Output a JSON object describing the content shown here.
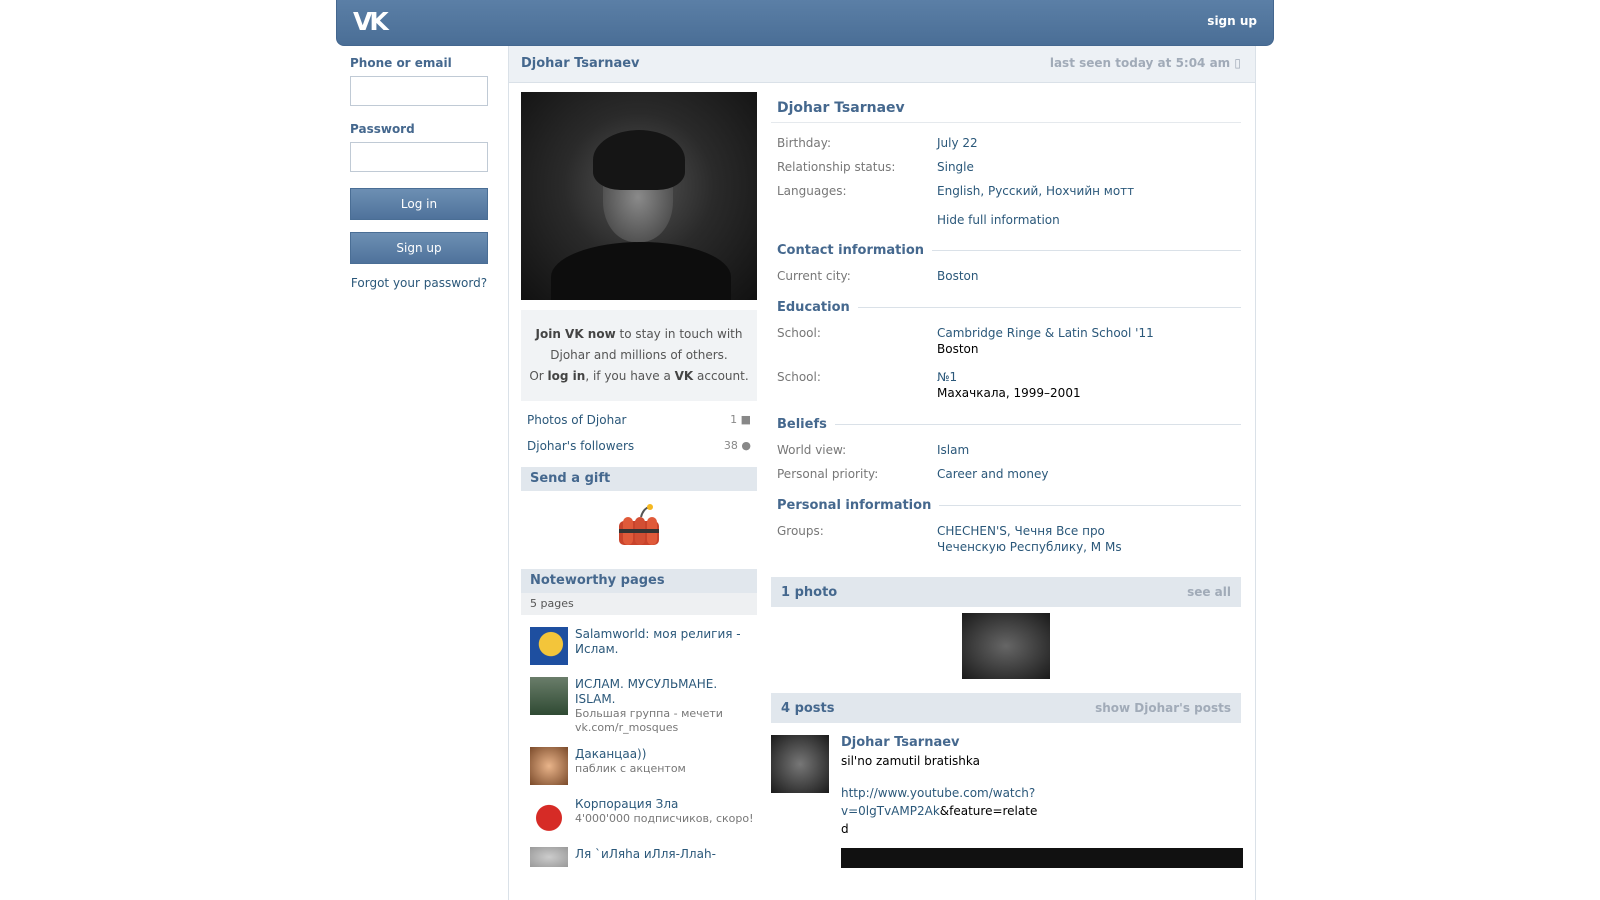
{
  "topbar": {
    "logo": "VK",
    "signup": "sign up"
  },
  "login": {
    "phone_label": "Phone or email",
    "password_label": "Password",
    "login_btn": "Log in",
    "signup_btn": "Sign up",
    "forgot": "Forgot your password?"
  },
  "header": {
    "name": "Djohar Tsarnaev",
    "last_seen": "last seen today at 5:04 am"
  },
  "join": {
    "join_vk": "Join VK now",
    "rest1": " to stay in touch with Djohar and millions of others.",
    "or": "Or ",
    "log_in": "log in",
    "rest2": ", if you have a ",
    "vk": "VK",
    "rest3": " account."
  },
  "stats": {
    "photos_label": "Photos of Djohar",
    "photos_count": "1",
    "followers_label": "Djohar's followers",
    "followers_count": "38"
  },
  "gift": {
    "title": "Send a gift"
  },
  "noteworthy": {
    "title": "Noteworthy pages",
    "count": "5 pages",
    "items": [
      {
        "title": "Salamworld: моя религия - Ислам.",
        "desc": ""
      },
      {
        "title": "ИСЛАМ. МУСУЛЬМАНЕ. ISLAM.",
        "desc": "Большая группа - мечети vk.com/r_mosques"
      },
      {
        "title": "Даканцаа))",
        "desc": "паблик с акцентом"
      },
      {
        "title": "Корпорация Зла",
        "desc": "4'000'000 подписчиков, скоро!"
      },
      {
        "title": "Ля `иЛяha иЛля-Ллаh-",
        "desc": ""
      }
    ]
  },
  "profile": {
    "name": "Djohar Tsarnaev",
    "birthday_k": "Birthday:",
    "birthday_v": "July 22",
    "rel_k": "Relationship status:",
    "rel_v": "Single",
    "lang_k": "Languages:",
    "lang_v": "English, Русский, Нохчийн мотт",
    "hide": "Hide full information",
    "contact_title": "Contact information",
    "city_k": "Current city:",
    "city_v": "Boston",
    "edu_title": "Education",
    "school1_k": "School:",
    "school1_v": "Cambridge Ringe & Latin School '11",
    "school1_sub": "Boston",
    "school2_k": "School:",
    "school2_v": "№1",
    "school2_sub": "Махачкала, 1999–2001",
    "beliefs_title": "Beliefs",
    "world_k": "World view:",
    "world_v": "Islam",
    "priority_k": "Personal priority:",
    "priority_v": "Career and money",
    "personal_title": "Personal information",
    "groups_k": "Groups:",
    "groups_v": "CHECHEN'S, Чечня Все про Чеченскую Республику, M Ms"
  },
  "photos": {
    "title": "1 photo",
    "see_all": "see all"
  },
  "posts": {
    "title": "4 posts",
    "show": "show Djohar's posts",
    "author": "Djohar Tsarnaev",
    "text": "sil'no zamutil bratishka",
    "link": "http://www.youtube.com/watch?v=0lgTvAMP2Ak",
    "link_rest": "&feature=related"
  },
  "colors": {
    "brand": "#4A6E96",
    "link": "#2B587A",
    "heading": "#45688E"
  }
}
